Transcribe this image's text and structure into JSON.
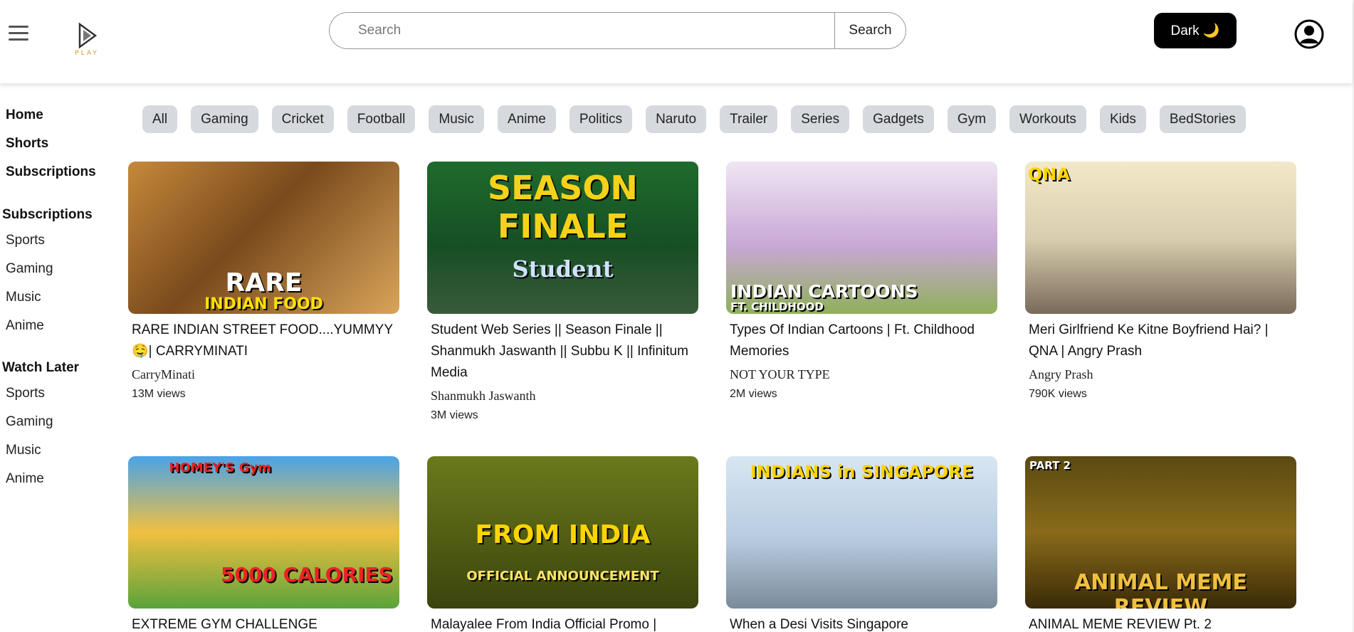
{
  "header": {
    "logo_text": "PLAY",
    "search_placeholder": "Search",
    "search_button": "Search",
    "theme_button": "Dark 🌙"
  },
  "sidebar": {
    "main": [
      "Home",
      "Shorts",
      "Subscriptions"
    ],
    "subscriptions_title": "Subscriptions",
    "subscriptions": [
      "Sports",
      "Gaming",
      "Music",
      "Anime"
    ],
    "watch_later_title": "Watch Later",
    "watch_later": [
      "Sports",
      "Gaming",
      "Music",
      "Anime"
    ]
  },
  "chips": [
    "All",
    "Gaming",
    "Cricket",
    "Football",
    "Music",
    "Anime",
    "Politics",
    "Naruto",
    "Trailer",
    "Series",
    "Gadgets",
    "Gym",
    "Workouts",
    "Kids",
    "BedStories"
  ],
  "videos": [
    {
      "title": "RARE INDIAN STREET FOOD....YUMMYY 🤤| CARRYMINATI",
      "channel": "CarryMinati",
      "views": "13M views",
      "thumb_text": [
        "RARE",
        "INDIAN FOOD"
      ]
    },
    {
      "title": "Student Web Series || Season Finale || Shanmukh Jaswanth || Subbu K || Infinitum Media",
      "channel": "Shanmukh Jaswanth",
      "views": "3M views",
      "thumb_text": [
        "SEASON FINALE",
        "Student"
      ]
    },
    {
      "title": "Types Of Indian Cartoons | Ft. Childhood Memories",
      "channel": "NOT YOUR TYPE",
      "views": "2M views",
      "thumb_text": [
        "INDIAN CARTOONS",
        "FT. CHILDHOOD"
      ]
    },
    {
      "title": "Meri Girlfriend Ke Kitne Boyfriend Hai? | QNA | Angry Prash",
      "channel": "Angry Prash",
      "views": "790K views",
      "thumb_text": [
        "QNA",
        ""
      ]
    },
    {
      "title": "EXTREME GYM CHALLENGE",
      "channel": "",
      "views": "",
      "thumb_text": [
        "HOMEY'S Gym",
        "5000 CALORIES"
      ]
    },
    {
      "title": "Malayalee From India Official Promo |",
      "channel": "",
      "views": "",
      "thumb_text": [
        "FROM INDIA",
        "OFFICIAL ANNOUNCEMENT"
      ]
    },
    {
      "title": "When a Desi Visits Singapore",
      "channel": "",
      "views": "",
      "thumb_text": [
        "INDIANS in SINGAPORE",
        ""
      ]
    },
    {
      "title": "ANIMAL MEME REVIEW Pt. 2",
      "channel": "",
      "views": "",
      "thumb_text": [
        "PART 2",
        "ANIMAL MEME REVIEW"
      ]
    }
  ]
}
